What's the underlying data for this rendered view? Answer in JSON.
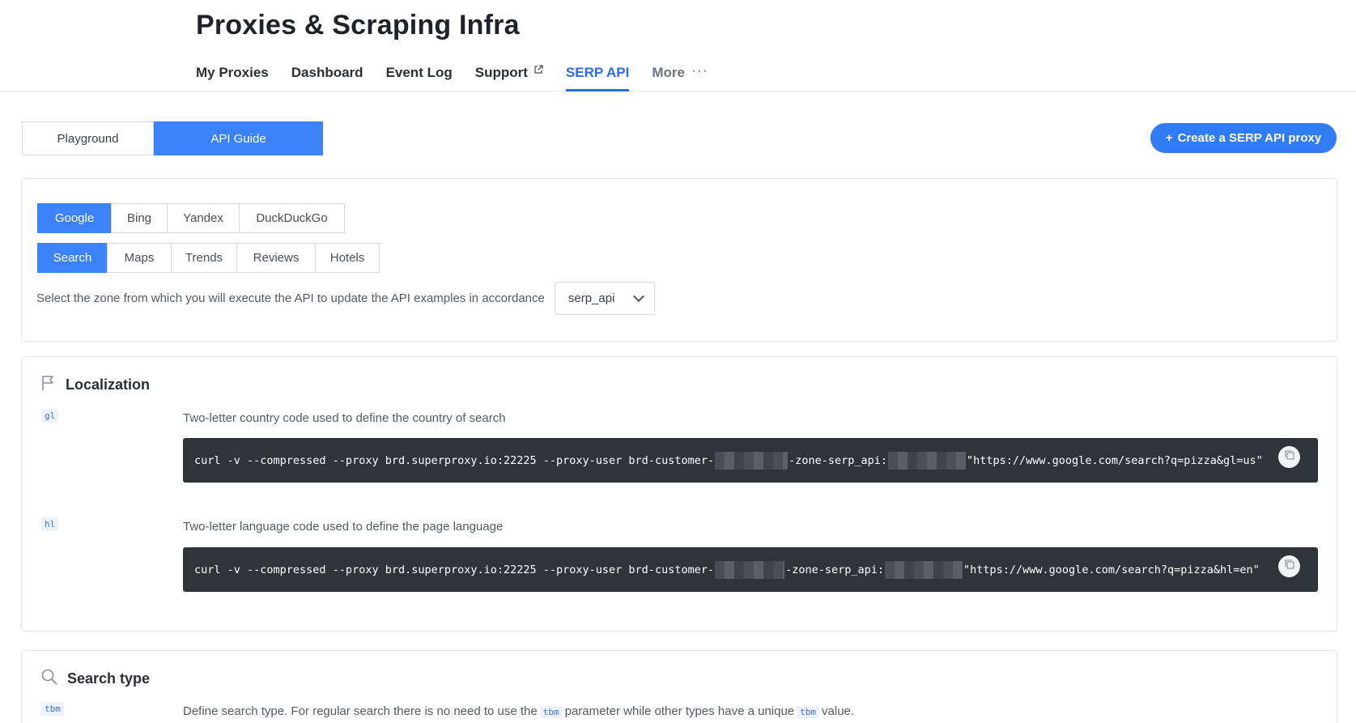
{
  "header": {
    "title": "Proxies & Scraping Infra",
    "nav": [
      {
        "label": "My Proxies"
      },
      {
        "label": "Dashboard"
      },
      {
        "label": "Event Log"
      },
      {
        "label": "Support"
      },
      {
        "label": "SERP API",
        "active": true
      },
      {
        "label": "More"
      }
    ]
  },
  "mode_toggle": {
    "playground": "Playground",
    "api_guide": "API Guide",
    "active": "API Guide"
  },
  "create_button": {
    "plus": "+",
    "label": "Create a SERP API proxy"
  },
  "engines": {
    "items": [
      "Google",
      "Bing",
      "Yandex",
      "DuckDuckGo"
    ],
    "active": "Google"
  },
  "search_types": {
    "items": [
      "Search",
      "Maps",
      "Trends",
      "Reviews",
      "Hotels"
    ],
    "active": "Search"
  },
  "zone": {
    "label": "Select the zone from which you will execute the API to update the API examples in accordance",
    "selected": "serp_api"
  },
  "localization": {
    "title": "Localization",
    "params": [
      {
        "tag": "gl",
        "description": "Two-letter country code used to define the country of search",
        "code_prefix": "curl -v --compressed --proxy brd.superproxy.io:22225 --proxy-user brd-customer-",
        "code_middle": "-zone-serp_api:",
        "code_suffix": " \"https://www.google.com/search?q=pizza&gl=us\""
      },
      {
        "tag": "hl",
        "description": "Two-letter language code used to define the page language",
        "code_prefix": "curl -v --compressed --proxy brd.superproxy.io:22225 --proxy-user brd-customer-",
        "code_middle": "-zone-serp_api:",
        "code_suffix": " \"https://www.google.com/search?q=pizza&hl=en\""
      }
    ]
  },
  "search_type": {
    "title": "Search type",
    "tag": "tbm",
    "desc_part1": "Define search type. For regular search there is no need to use the",
    "desc_code1": "tbm",
    "desc_part2": "parameter while other types have a unique",
    "desc_code2": "tbm",
    "desc_part3": "value."
  },
  "colors": {
    "accent": "#3b82f6",
    "nav_active": "#2b6de8",
    "code_bg": "#2f343b"
  }
}
